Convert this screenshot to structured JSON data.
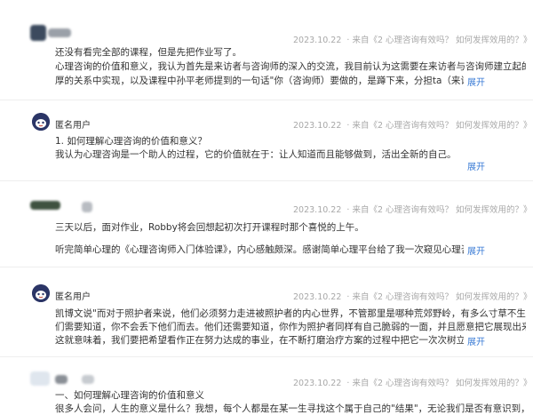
{
  "posts": [
    {
      "date": "2023.10.22",
      "source": "· 来自《2 心理咨询有效吗？ 如何发挥效用的？》",
      "lines": [
        "还没有看完全部的课程，但是先把作业写了。",
        "心理咨询的价值和意义，我认为首先是来访者与咨询师的深入的交流，我目前认为这需要在来访者与咨询师建立起的深",
        "厚的关系中实现，以及课程中孙平老师提到的一句话\"你（咨询师）要做的，是蹲下来，分担ta（来访者）作为一"
      ],
      "expand": "展开"
    },
    {
      "user": "匿名用户",
      "date": "2023.10.22",
      "source": "· 来自《2 心理咨询有效吗？ 如何发挥效用的？》",
      "lines": [
        "1. 如何理解心理咨询的价值和意义？",
        "我认为心理咨询是一个助人的过程，它的价值就在于：让人知道而且能够做到，活出全新的自己。"
      ],
      "expand": "展开"
    },
    {
      "date": "2023.10.22",
      "source": "· 来自《2 心理咨询有效吗？ 如何发挥效用的？》",
      "lines": [
        "三天以后，面对作业，Robby将会回想起初次打开课程时那个喜悦的上午。",
        "听完简单心理的《心理咨询师入门体验课》，内心感触颇深。感谢简单心理平台给了我一次窥见心理咨询师行"
      ],
      "expand": "展开"
    },
    {
      "user": "匿名用户",
      "date": "2023.10.22",
      "source": "· 来自《2 心理咨询有效吗？ 如何发挥效用的？》",
      "lines": [
        "凯博文说\"而对于照护者来说，他们必须努力走进被照护者的内心世界，不管那里是哪种荒郊野岭，有多么寸草不生。他",
        "们需要知道，你不会丢下他们而去。他们还需要知道，你作为照护者同样有自己脆弱的一面，并且愿意把它展现出来。",
        "这就意味着，我们要把希望看作正在努力达成的事业，在不断打磨治疗方案的过程中把它一次次树立起来。而在"
      ],
      "expand": "展开"
    },
    {
      "date": "2023.10.22",
      "source": "· 来自《2 心理咨询有效吗？ 如何发挥效用的？》",
      "lines": [
        "一、如何理解心理咨询的价值和意义",
        "很多人会问，人生的意义是什么？我想，每个人都是在某一生寻找这个属于自己的\"结果\"，无论我们是否有意识到，这"
      ]
    }
  ]
}
